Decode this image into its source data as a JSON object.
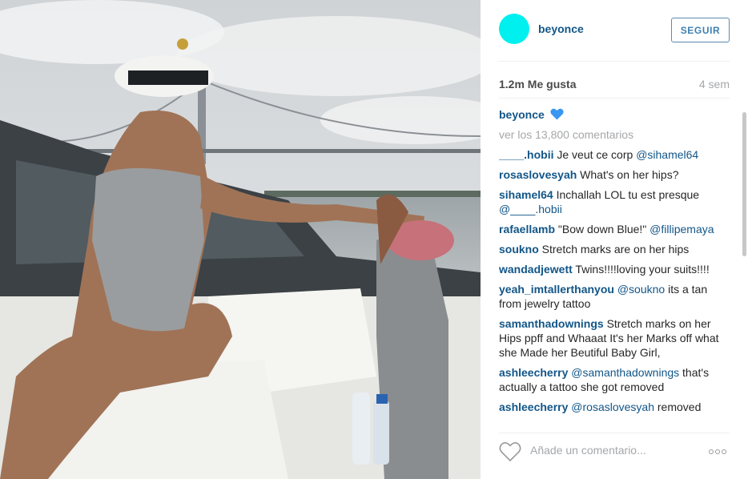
{
  "post": {
    "username": "beyonce",
    "follow_label": "SEGUIR",
    "likes": "1.2m Me gusta",
    "time": "4 sem",
    "caption_author": "beyonce",
    "view_more": "ver los 13,800 comentarios",
    "comment_placeholder": "Añade un comentario...",
    "colors": {
      "link": "#125688",
      "avatar": "#00f0f0",
      "heart": "#3897f0"
    }
  },
  "comments": [
    {
      "author": "____.hobii",
      "text": " Je veut ce corp ",
      "mention": "@sihamel64"
    },
    {
      "author": "rosaslovesyah",
      "text": " What's on her hips?",
      "mention": ""
    },
    {
      "author": "sihamel64",
      "text": " Inchallah LOL tu est presque ",
      "mention": "@____.hobii"
    },
    {
      "author": "rafaellamb",
      "text": " \"Bow down Blue!\" ",
      "mention": "@fillipemaya"
    },
    {
      "author": "soukno",
      "text": " Stretch marks are on her hips",
      "mention": ""
    },
    {
      "author": "wandadjewett",
      "text": " Twins!!!!loving your suits!!!!",
      "mention": ""
    },
    {
      "author": "yeah_imtallerthanyou",
      "text": " its a tan from jewelry tattoo",
      "mention": "@soukno",
      "mention_first": true
    },
    {
      "author": "samanthadownings",
      "text": " Stretch marks on her Hips ppff and Whaaat It's her Marks off what she Made her Beutiful Baby Girl,",
      "mention": ""
    },
    {
      "author": "ashleecherry",
      "text": " that's actually a tattoo she got removed",
      "mention": "@samanthadownings",
      "mention_first": true
    },
    {
      "author": "ashleecherry",
      "text": " removed",
      "mention": "@rosaslovesyah",
      "mention_first": true
    }
  ]
}
